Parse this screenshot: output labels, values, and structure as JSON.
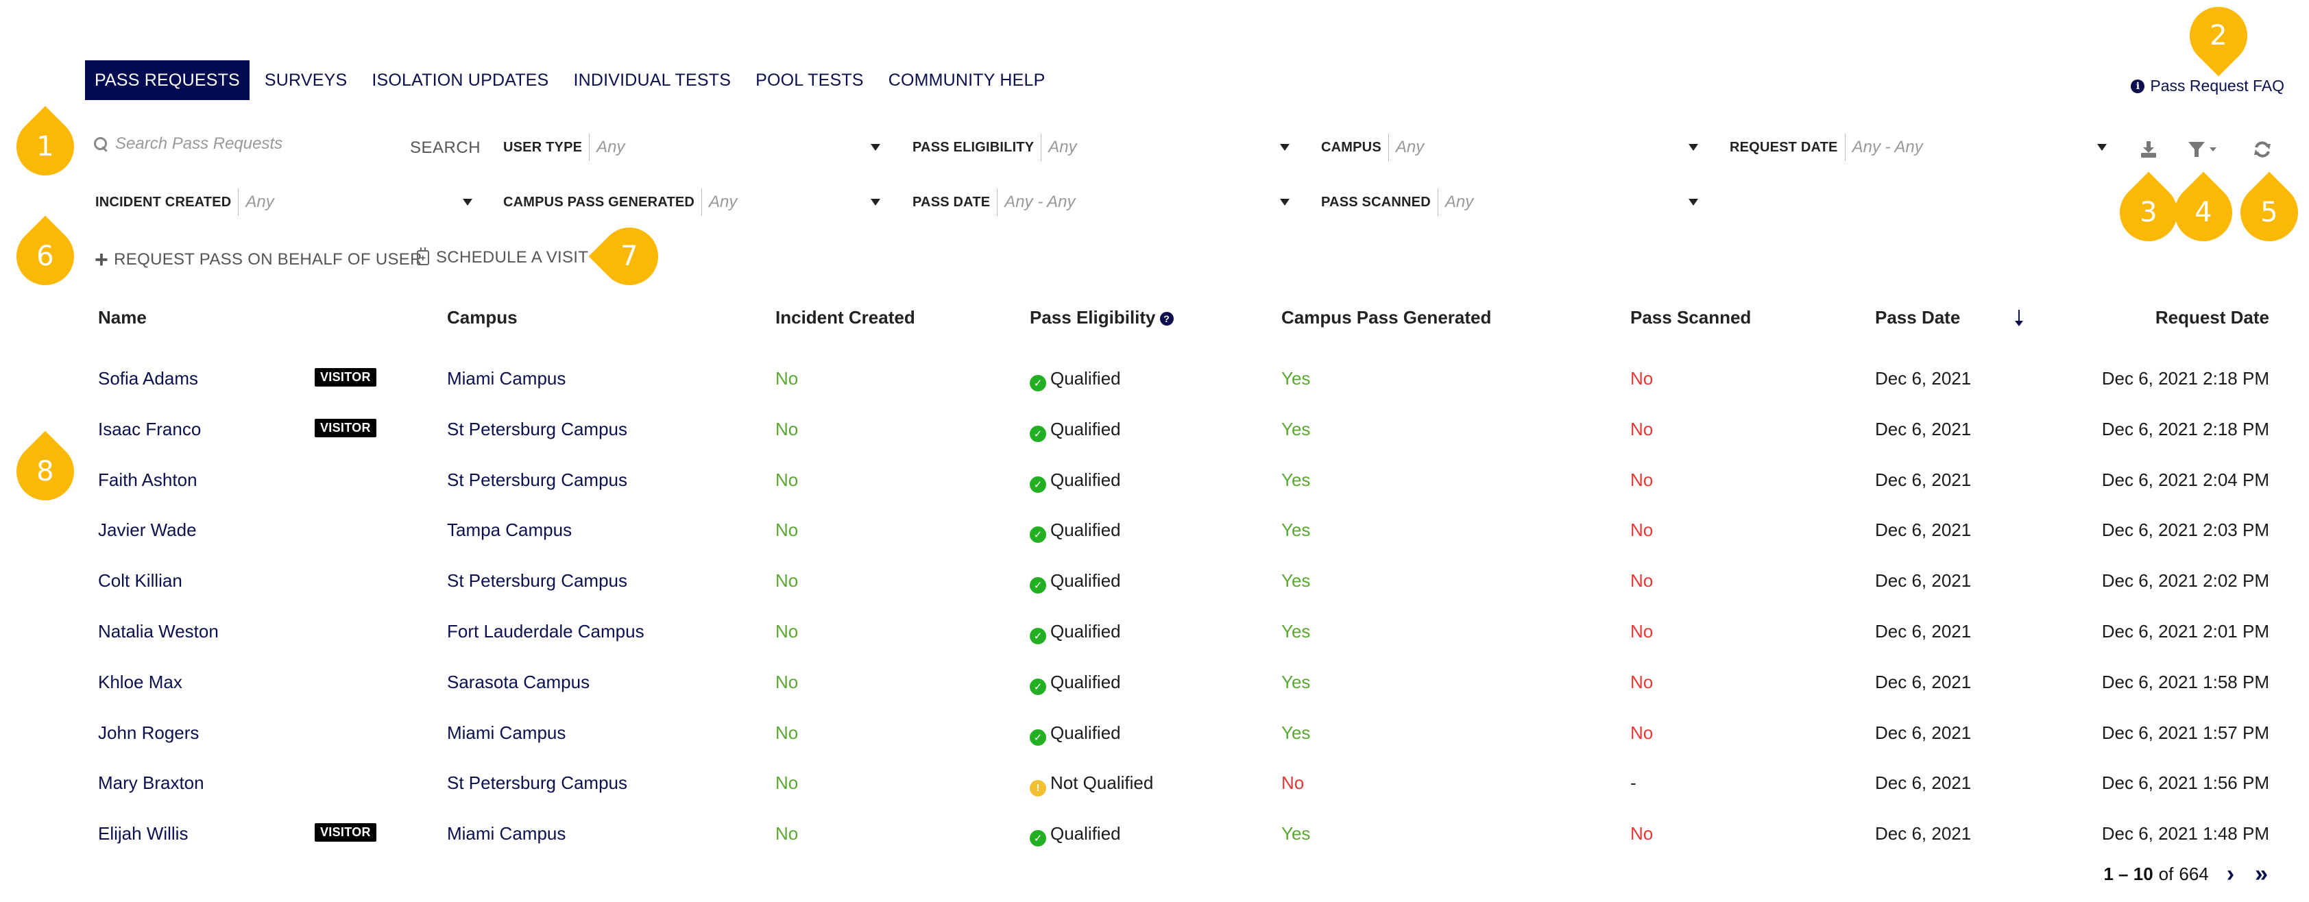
{
  "nav": {
    "tabs": [
      {
        "label": "PASS REQUESTS",
        "active": true
      },
      {
        "label": "SURVEYS",
        "active": false
      },
      {
        "label": "ISOLATION UPDATES",
        "active": false
      },
      {
        "label": "INDIVIDUAL TESTS",
        "active": false
      },
      {
        "label": "POOL TESTS",
        "active": false
      },
      {
        "label": "COMMUNITY HELP",
        "active": false
      }
    ],
    "faq_link": "Pass Request FAQ"
  },
  "search": {
    "placeholder": "Search Pass Requests",
    "value": "",
    "button": "SEARCH"
  },
  "filters": [
    {
      "label": "USER TYPE",
      "value": "Any"
    },
    {
      "label": "PASS ELIGIBILITY",
      "value": "Any"
    },
    {
      "label": "CAMPUS",
      "value": "Any"
    },
    {
      "label": "REQUEST DATE",
      "value": "Any - Any"
    },
    {
      "label": "INCIDENT CREATED",
      "value": "Any"
    },
    {
      "label": "CAMPUS PASS GENERATED",
      "value": "Any"
    },
    {
      "label": "PASS DATE",
      "value": "Any - Any"
    },
    {
      "label": "PASS SCANNED",
      "value": "Any"
    }
  ],
  "toolbar": {
    "icons": [
      "download-icon",
      "filter-icon",
      "refresh-icon"
    ]
  },
  "actions": {
    "request_pass": "REQUEST PASS ON BEHALF OF USER",
    "schedule_visit": "SCHEDULE A VISIT"
  },
  "table": {
    "columns": [
      "Name",
      "Campus",
      "Incident Created",
      "Pass Eligibility",
      "Campus Pass Generated",
      "Pass Scanned",
      "Pass Date",
      "Request Date"
    ],
    "sorted_column": "Request Date",
    "sort_direction": "descending",
    "rows": [
      {
        "name": "Sofia Adams",
        "badge": "VISITOR",
        "campus": "Miami Campus",
        "incident": "No",
        "eligibility": "Qualified",
        "generated": "Yes",
        "scanned": "No",
        "pass_date": "Dec 6, 2021",
        "request_date": "Dec 6, 2021 2:18 PM"
      },
      {
        "name": "Isaac Franco",
        "badge": "VISITOR",
        "campus": "St Petersburg Campus",
        "incident": "No",
        "eligibility": "Qualified",
        "generated": "Yes",
        "scanned": "No",
        "pass_date": "Dec 6, 2021",
        "request_date": "Dec 6, 2021 2:18 PM"
      },
      {
        "name": "Faith Ashton",
        "badge": "",
        "campus": "St Petersburg Campus",
        "incident": "No",
        "eligibility": "Qualified",
        "generated": "Yes",
        "scanned": "No",
        "pass_date": "Dec 6, 2021",
        "request_date": "Dec 6, 2021 2:04 PM"
      },
      {
        "name": "Javier Wade",
        "badge": "",
        "campus": "Tampa Campus",
        "incident": "No",
        "eligibility": "Qualified",
        "generated": "Yes",
        "scanned": "No",
        "pass_date": "Dec 6, 2021",
        "request_date": "Dec 6, 2021 2:03 PM"
      },
      {
        "name": "Colt Killian",
        "badge": "",
        "campus": "St Petersburg Campus",
        "incident": "No",
        "eligibility": "Qualified",
        "generated": "Yes",
        "scanned": "No",
        "pass_date": "Dec 6, 2021",
        "request_date": "Dec 6, 2021 2:02 PM"
      },
      {
        "name": "Natalia Weston",
        "badge": "",
        "campus": "Fort Lauderdale Campus",
        "incident": "No",
        "eligibility": "Qualified",
        "generated": "Yes",
        "scanned": "No",
        "pass_date": "Dec 6, 2021",
        "request_date": "Dec 6, 2021 2:01 PM"
      },
      {
        "name": "Khloe Max",
        "badge": "",
        "campus": "Sarasota Campus",
        "incident": "No",
        "eligibility": "Qualified",
        "generated": "Yes",
        "scanned": "No",
        "pass_date": "Dec 6, 2021",
        "request_date": "Dec 6, 2021 1:58 PM"
      },
      {
        "name": "John Rogers",
        "badge": "",
        "campus": "Miami Campus",
        "incident": "No",
        "eligibility": "Qualified",
        "generated": "Yes",
        "scanned": "No",
        "pass_date": "Dec 6, 2021",
        "request_date": "Dec 6, 2021 1:57 PM"
      },
      {
        "name": "Mary Braxton",
        "badge": "",
        "campus": "St Petersburg Campus",
        "incident": "No",
        "eligibility": "Not Qualified",
        "generated": "No",
        "scanned": "-",
        "pass_date": "Dec 6, 2021",
        "request_date": "Dec 6, 2021 1:56 PM"
      },
      {
        "name": "Elijah Willis",
        "badge": "VISITOR",
        "campus": "Miami Campus",
        "incident": "No",
        "eligibility": "Qualified",
        "generated": "Yes",
        "scanned": "No",
        "pass_date": "Dec 6, 2021",
        "request_date": "Dec 6, 2021 1:48 PM"
      }
    ]
  },
  "pagination": {
    "range": "1 – 10",
    "of_label": "of",
    "total": "664"
  },
  "callouts": [
    "1",
    "2",
    "3",
    "4",
    "5",
    "6",
    "7",
    "8"
  ],
  "colors": {
    "brand_navy": "#020b52",
    "link_navy": "#0b0f4e",
    "yes_green": "#5aa832",
    "no_red": "#e53935",
    "qualified_green": "#22b022",
    "warning_yellow": "#f2c02e",
    "callout_yellow": "#fbb907"
  }
}
